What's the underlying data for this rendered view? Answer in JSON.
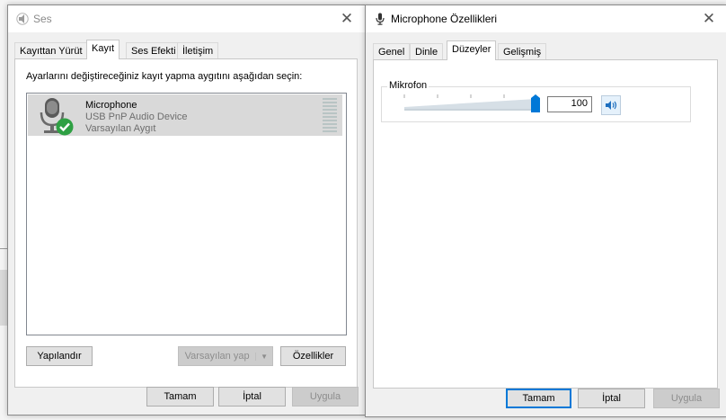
{
  "sound_window": {
    "title": "Ses",
    "tabs": [
      "Kayıttan Yürüt",
      "Kayıt",
      "Ses Efekti",
      "İletişim"
    ],
    "active_tab": "Kayıt",
    "instruction": "Ayarlarını değiştireceğiniz kayıt yapma aygıtını aşağıdan seçin:",
    "device": {
      "name": "Microphone",
      "description": "USB PnP Audio Device",
      "status": "Varsayılan Aygıt"
    },
    "buttons": {
      "configure": "Yapılandır",
      "set_default": "Varsayılan yap",
      "properties": "Özellikler"
    },
    "footer": {
      "ok": "Tamam",
      "cancel": "İptal",
      "apply": "Uygula"
    }
  },
  "mic_window": {
    "title": "Microphone Özellikleri",
    "tabs": [
      "Genel",
      "Dinle",
      "Düzeyler",
      "Gelişmiş"
    ],
    "active_tab": "Düzeyler",
    "group_label": "Mikrofon",
    "level": 100,
    "footer": {
      "ok": "Tamam",
      "cancel": "İptal",
      "apply": "Uygula"
    }
  },
  "colors": {
    "accent": "#0078d7",
    "success": "#2ea043"
  }
}
